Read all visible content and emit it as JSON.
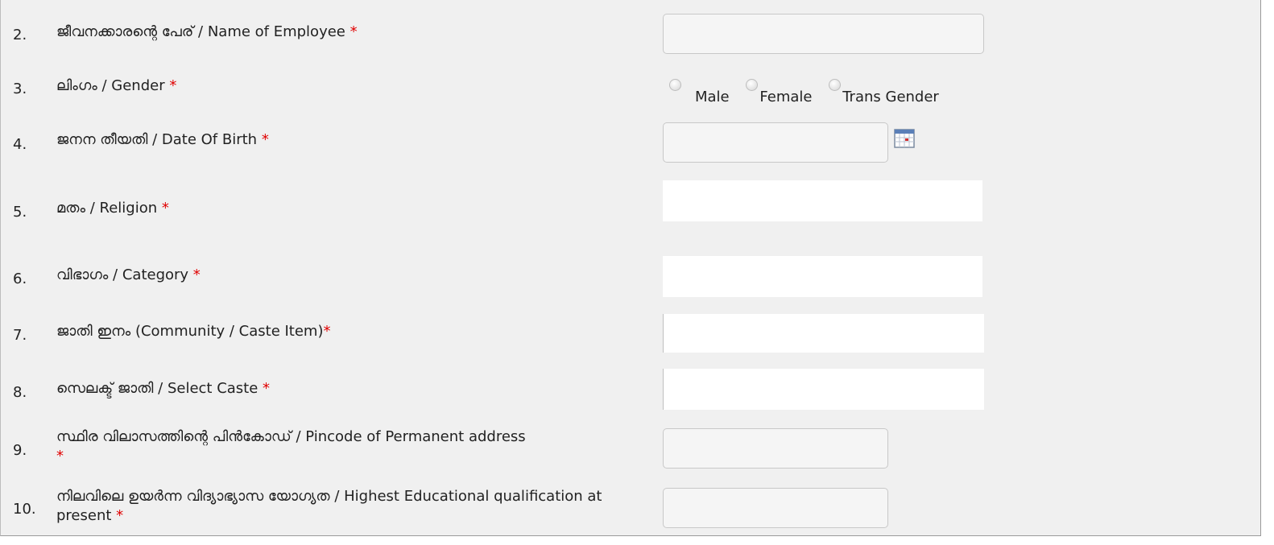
{
  "rows": [
    {
      "num": "2.",
      "label": "ജീവനക്കാരന്റെ പേര് / Name of Employee",
      "star": "*"
    },
    {
      "num": "3.",
      "label": "ലിംഗം / Gender",
      "star": "*"
    },
    {
      "num": "4.",
      "label": "ജനന തീയതി / Date Of Birth",
      "star": "*"
    },
    {
      "num": "5.",
      "label": "മതം / Religion",
      "star": "*"
    },
    {
      "num": "6.",
      "label": "വിഭാഗം / Category",
      "star": "*"
    },
    {
      "num": "7.",
      "label": "ജാതി ഇനം (Community / Caste Item)",
      "star": "*"
    },
    {
      "num": "8.",
      "label": "സെലക്ട് ജാതി / Select Caste",
      "star": "*"
    },
    {
      "num": "9.",
      "label": "സ്ഥിര വിലാസത്തിന്റെ പിൻകോഡ് / Pincode of Permanent address",
      "star": "*"
    },
    {
      "num": "10.",
      "label": "നിലവിലെ ഉയർന്ന വിദ്യാഭ്യാസ യോഗ്യത / Highest Educational qualification at present",
      "star": "*"
    }
  ],
  "gender_options": [
    "Male",
    "Female",
    "Trans Gender"
  ],
  "fields": {
    "name_of_employee": "",
    "date_of_birth": "",
    "religion": "",
    "category": "",
    "caste_item": "",
    "select_caste": "",
    "pincode": "",
    "qualification": ""
  },
  "icons": {
    "calendar": "calendar-icon"
  },
  "colors": {
    "required_star": "#e00000",
    "panel_bg": "#f0f0f0"
  }
}
